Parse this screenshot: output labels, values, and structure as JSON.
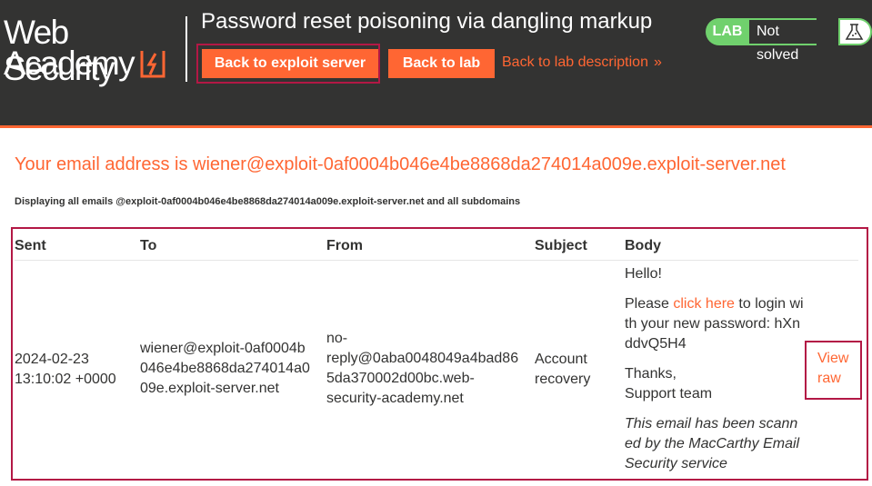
{
  "header": {
    "logo_line1": "Web Security",
    "logo_line2": "Academy",
    "lab_title": "Password reset poisoning via dangling markup",
    "exploit_button": "Back to exploit server",
    "lab_button": "Back to lab",
    "description_link": "Back to lab description",
    "description_chevron": "»",
    "badge_lab": "LAB",
    "badge_status": "Not solved",
    "flask_icon": "flask-icon"
  },
  "colors": {
    "accent": "#ff6633",
    "header_bg": "#333332",
    "highlight": "#b31845",
    "badge_green": "#70d16d"
  },
  "main": {
    "email_address_line": "Your email address is wiener@exploit-0af0004b046e4be8868da274014a009e.exploit-server.net",
    "displaying_line": "Displaying all emails @exploit-0af0004b046e4be8868da274014a009e.exploit-server.net and all subdomains"
  },
  "table": {
    "columns": [
      "Sent",
      "To",
      "From",
      "Subject",
      "Body"
    ],
    "rows": [
      {
        "sent_line1": "2024-02-23",
        "sent_line2": "13:10:02 +0000",
        "to_line1": "wiener@exploit-0af0004b",
        "to_line2": "046e4be8868da274014a0",
        "to_line3": "09e.exploit-server.net",
        "from_line1": "no-",
        "from_line2": "reply@0aba0048049a4bad86",
        "from_line3": "5da370002d00bc.web-",
        "from_line4": "security-academy.net",
        "subject_line1": "Account",
        "subject_line2": "recovery",
        "body_hello": "Hello!",
        "body_please": "Please ",
        "body_link": "click here",
        "body_login1": " to login wi",
        "body_login2": "th your new password: hXn",
        "body_login3": "ddvQ5H4",
        "body_thanks": "Thanks,",
        "body_team": "Support team",
        "body_scan1": "This email has been scann",
        "body_scan2": "ed by the MacCarthy Email",
        "body_scan3": "Security service",
        "view_raw_line1": "View",
        "view_raw_line2": "raw"
      }
    ]
  }
}
